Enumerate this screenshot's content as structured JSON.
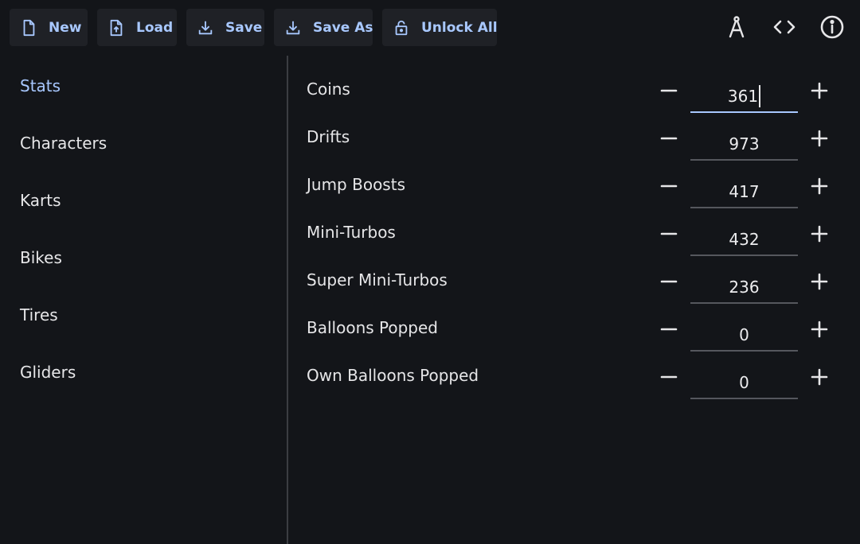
{
  "toolbar": {
    "new_label": "New",
    "load_label": "Load",
    "save_label": "Save",
    "save_as_label": "Save As",
    "unlock_all_label": "Unlock All",
    "icons": [
      "file-icon",
      "upload-file-icon",
      "download-icon",
      "download-icon",
      "lock-open-icon",
      "compass-icon",
      "code-icon",
      "info-icon"
    ]
  },
  "sidebar": {
    "items": [
      {
        "label": "Stats",
        "active": true
      },
      {
        "label": "Characters"
      },
      {
        "label": "Karts"
      },
      {
        "label": "Bikes"
      },
      {
        "label": "Tires"
      },
      {
        "label": "Gliders"
      }
    ]
  },
  "stats": [
    {
      "label": "Coins",
      "value": "361"
    },
    {
      "label": "Drifts",
      "value": "973"
    },
    {
      "label": "Jump Boosts",
      "value": "417"
    },
    {
      "label": "Mini-Turbos",
      "value": "432"
    },
    {
      "label": "Super Mini-Turbos",
      "value": "236"
    },
    {
      "label": "Balloons Popped",
      "value": "0"
    },
    {
      "label": "Own Balloons Popped",
      "value": "0"
    }
  ],
  "colors": {
    "background": "#131519",
    "button_bg": "#1f2126",
    "accent": "#a8c8ff",
    "text": "#e6e6e8",
    "divider": "#3b3d42"
  }
}
